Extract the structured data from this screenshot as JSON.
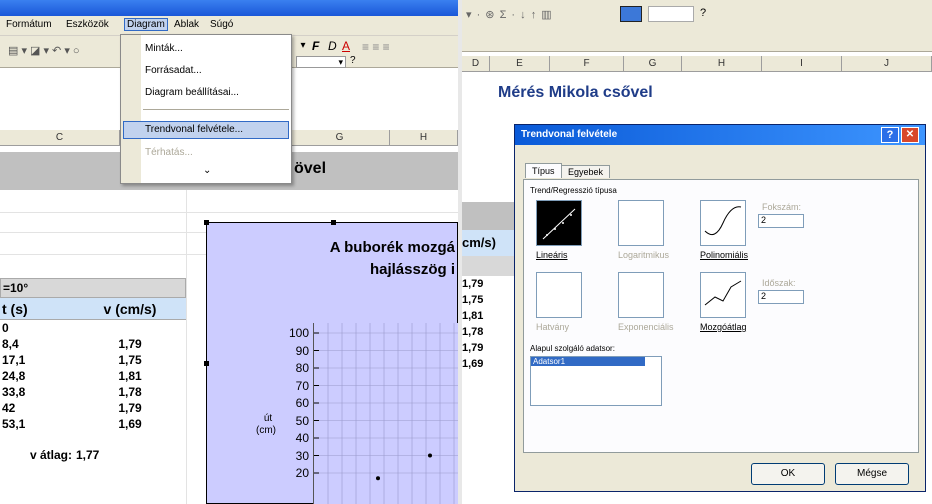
{
  "left_menu": {
    "items": [
      "Formátum",
      "Eszközök",
      "Diagram",
      "Ablak",
      "Súgó"
    ]
  },
  "dropdown": {
    "items": [
      "Minták...",
      "Forrásadat...",
      "Diagram beállításai...",
      "Trendvonal felvétele...",
      "Térhatás..."
    ],
    "highlighted": "Trendvonal felvétele...",
    "more_chevron": "⌄"
  },
  "toolbar_left": {
    "font_buttons": [
      "F",
      "D",
      "A"
    ],
    "help_symbol": "?"
  },
  "left_cols": [
    "C",
    "G",
    "H"
  ],
  "left_title_fragment": "övel",
  "table": {
    "angle": "=10°",
    "headers": [
      "t (s)",
      "v (cm/s)"
    ],
    "rows": [
      [
        "0",
        ""
      ],
      [
        "8,4",
        "1,79"
      ],
      [
        "17,1",
        "1,75"
      ],
      [
        "24,8",
        "1,81"
      ],
      [
        "33,8",
        "1,78"
      ],
      [
        "42",
        "1,79"
      ],
      [
        "53,1",
        "1,69"
      ]
    ],
    "avg_label": "v átlag:",
    "avg_value": "1,77"
  },
  "chart_data": {
    "type": "scatter",
    "title": "A buborék mozgá",
    "title_line2": "hajlásszög i",
    "ylabel_line1": "út",
    "ylabel_line2": "(cm)",
    "yticks": [
      "100",
      "90",
      "80",
      "70",
      "60",
      "50",
      "40",
      "30",
      "20"
    ],
    "ylim": [
      20,
      100
    ],
    "points": [
      {
        "x": 0,
        "y": 30
      },
      {
        "x": 0,
        "y": 17
      }
    ]
  },
  "right_toolbar": {
    "help_symbol": "?"
  },
  "right_cols": [
    "D",
    "E",
    "F",
    "G",
    "H",
    "I",
    "J"
  ],
  "right_title": "Mérés Mikola csővel",
  "right_partial_header": "cm/s)",
  "right_partial_values": [
    "1,79",
    "1,75",
    "1,81",
    "1,78",
    "1,79",
    "1,69"
  ],
  "dialog": {
    "title": "Trendvonal felvétele",
    "tabs": [
      "Típus",
      "Egyebek"
    ],
    "group_label": "Trend/Regresszió típusa",
    "types": [
      "Lineáris",
      "Logaritmikus",
      "Polinomiális",
      "Hatvány",
      "Exponenciális",
      "Mozgóátlag"
    ],
    "order_label": "Fokszám:",
    "order_value": "2",
    "period_label": "Időszak:",
    "period_value": "2",
    "series_label": "Alapul szolgáló adatsor:",
    "series_items": [
      "Adatsor1"
    ],
    "ok": "OK",
    "cancel": "Mégse",
    "help_btn": "?",
    "close_btn": "✕"
  }
}
